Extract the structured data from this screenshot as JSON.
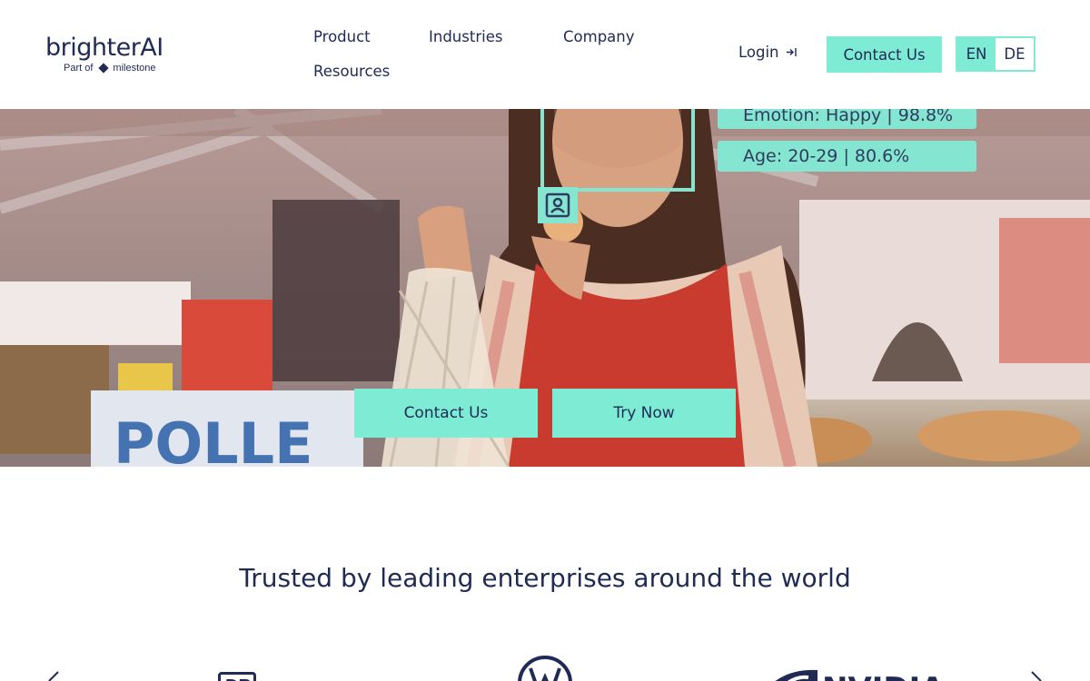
{
  "header": {
    "logo": {
      "brand": "brighterAI",
      "sub_prefix": "Part of",
      "sub_brand": "milestone"
    },
    "nav": [
      {
        "label": "Product"
      },
      {
        "label": "Industries"
      },
      {
        "label": "Company"
      },
      {
        "label": "Resources"
      }
    ],
    "login_label": "Login",
    "contact_label": "Contact Us",
    "languages": [
      {
        "code": "EN",
        "active": true
      },
      {
        "code": "DE",
        "active": false
      }
    ]
  },
  "hero": {
    "tags": {
      "emotion": "Emotion: Happy | 98.8%",
      "age": "Age: 20-29 | 80.6%"
    },
    "sign_text": "POLLE",
    "contact_label": "Contact Us",
    "try_label": "Try Now"
  },
  "trusted": {
    "heading": "Trusted by leading enterprises around the world",
    "logos": [
      {
        "name": "DB",
        "icon": "db-logo"
      },
      {
        "name": "VW",
        "icon": "vw-logo"
      },
      {
        "name": "NVIDIA",
        "icon": "nvidia-logo"
      }
    ]
  },
  "colors": {
    "accent": "#7eecd5",
    "text": "#1f2a55"
  }
}
